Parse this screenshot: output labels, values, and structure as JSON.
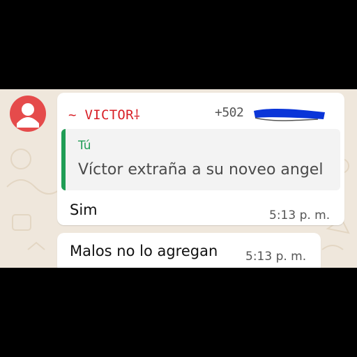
{
  "colors": {
    "sender": "#d81f26",
    "quote_accent": "#1f9d55",
    "avatar_bg": "#e54b4b",
    "redaction": "#0a35d8",
    "chat_bg": "#efe7dc"
  },
  "chat": {
    "avatar_icon": "default-avatar-icon",
    "messages": [
      {
        "sender_name": "~ VICTOR⸸",
        "sender_phone": "+502",
        "phone_redacted": true,
        "quoted": {
          "author": "Tú",
          "text": "Víctor extraña a su noveo angel"
        },
        "text": "Sim",
        "time": "5:13 p. m."
      },
      {
        "text": "Malos no lo agregan",
        "time": "5:13 p. m."
      }
    ]
  }
}
